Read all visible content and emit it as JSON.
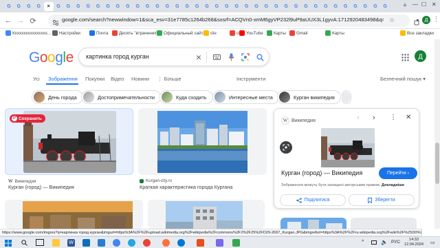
{
  "browser": {
    "tabs": [
      {
        "label": "G",
        "color": "#4285f4"
      },
      {
        "label": "G",
        "color": "#4285f4"
      },
      {
        "label": "G",
        "color": "#4285f4"
      },
      {
        "label": "G",
        "color": "#4285f4"
      },
      {
        "label": "G",
        "color": "#4285f4"
      },
      {
        "label": "G",
        "color": "#4285f4"
      },
      {
        "label": "G",
        "color": "#4285f4"
      },
      {
        "label": "G",
        "color": "#4285f4"
      },
      {
        "label": "G",
        "color": "#4285f4"
      },
      {
        "label": "G",
        "color": "#4285f4"
      },
      {
        "label": "G",
        "color": "#4285f4"
      },
      {
        "label": "G",
        "color": "#4285f4"
      },
      {
        "label": "G",
        "color": "#4285f4"
      },
      {
        "label": "G",
        "color": "#4285f4"
      },
      {
        "label": "G",
        "color": "#4285f4"
      },
      {
        "label": "G",
        "color": "#4285f4"
      },
      {
        "label": "G",
        "color": "#4285f4"
      },
      {
        "label": "G",
        "color": "#4285f4"
      },
      {
        "label": "G",
        "color": "#4285f4"
      },
      {
        "label": "G",
        "color": "#4285f4"
      },
      {
        "label": "G",
        "color": "#4285f4"
      },
      {
        "label": "G",
        "color": "#4285f4"
      },
      {
        "label": "G",
        "color": "#4285f4"
      },
      {
        "label": "G",
        "color": "#4285f4"
      },
      {
        "label": "G",
        "color": "#4285f4"
      },
      {
        "label": "G",
        "color": "#4285f4"
      },
      {
        "label": "G",
        "color": "#4285f4"
      },
      {
        "label": "G",
        "color": "#4285f4"
      },
      {
        "label": "G",
        "color": "#4285f4"
      },
      {
        "label": "G",
        "color": "#4285f4"
      },
      {
        "label": "G",
        "color": "#4285f4"
      },
      {
        "label": "G",
        "color": "#4285f4"
      },
      {
        "label": "G",
        "color": "#4285f4"
      },
      {
        "label": "G",
        "color": "#4285f4"
      },
      {
        "label": "G",
        "color": "#4285f4"
      },
      {
        "label": "G",
        "color": "#4285f4"
      },
      {
        "label": "G",
        "color": "#4285f4"
      },
      {
        "label": "G",
        "color": "#4285f4"
      },
      {
        "label": "G",
        "color": "#4285f4"
      }
    ],
    "new_tab": "+",
    "window_controls": {
      "minimize": "—",
      "maximize": "☐",
      "close": "✕"
    },
    "back": "←",
    "forward": "→",
    "reload": "⟳",
    "url": "google.com/search?newwindow=1&sca_esv=31e7785c1264b268&sxsrf=ACQVn0-xmM6gyVP232l9uP9aUUX3L1gyvA:1712920483498&q=картинка+город...",
    "profile_letter": "Д",
    "bookmarks": [
      {
        "label": "Кххххххххххххххх...",
        "color": "#4285f4"
      },
      {
        "label": "Настройки",
        "color": "#5f6368"
      },
      {
        "label": "Почта",
        "color": "#1a73e8"
      },
      {
        "label": "Десять \"втрачених\"...",
        "color": "#ea4335"
      },
      {
        "label": "Официальный сайт...",
        "color": "#34a853"
      },
      {
        "label": "оїн",
        "color": "#fbbc04"
      },
      {
        "label": "от",
        "color": "#ea4335"
      },
      {
        "label": "YouTube",
        "color": "#ff0000"
      },
      {
        "label": "Карты",
        "color": "#34a853"
      },
      {
        "label": "Gmail",
        "color": "#ea4335"
      },
      {
        "label": "Карты",
        "color": "#34a853"
      }
    ],
    "all_bookmarks": "Все закладки"
  },
  "google": {
    "logo": [
      "G",
      "o",
      "o",
      "g",
      "l",
      "e"
    ],
    "logo_colors": [
      "#4285f4",
      "#ea4335",
      "#fbbc04",
      "#4285f4",
      "#34a853",
      "#ea4335"
    ],
    "query": "картинка город курган",
    "clear_icon": "×",
    "apps_icon": "apps-grid",
    "avatar_letter": "Д",
    "nav_tabs": [
      "Усі",
      "Зображення",
      "Покупки",
      "Відео",
      "Новини",
      "⋮ Більше"
    ],
    "tools": "Інструменти",
    "safe_search": "Безпечний пошук ▾",
    "chips": [
      "День города",
      "Достопримечательности",
      "Куда сходить",
      "Интересные места",
      "Курган википедия"
    ]
  },
  "results": [
    {
      "source": "Википедия",
      "title": "Курган (город) — Википедия",
      "save_label": "Сохранить"
    },
    {
      "source": "Kurgan-city.ru",
      "title": "Краткая характеристика города Кургана"
    }
  ],
  "panel": {
    "source": "Википедия",
    "title": "Курган (город) — Википедия",
    "visit": "Перейти ›",
    "copyright": "Зображення можуть бути захищені авторським правом.",
    "more": "Докладніше",
    "share": "Поділитися",
    "save": "Зберегти"
  },
  "status_url": "https://www.google.com/imgres?q=картинка город курган&imgurl=https%3A%2F%2Fupload.wikimedia.org%2Fwikipedia%2Fcommons%2F2%2F25%2FD29-2697_Kurgan.JPG&imgrefurl=https%3A%2F%2Fru.wikipedia.org%2Fwiki%2F%25D0%25BA...",
  "taskbar": {
    "lang": "РУС",
    "time": "14:33",
    "date": "12.04.2024"
  }
}
